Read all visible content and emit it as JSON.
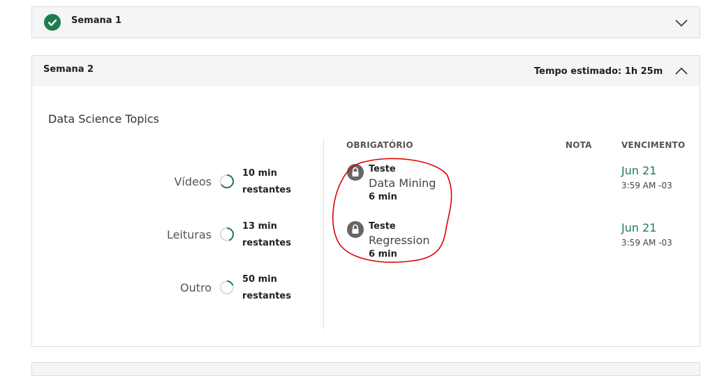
{
  "week1": {
    "title": "Semana 1",
    "completed": true,
    "expanded": false
  },
  "week2": {
    "title": "Semana 2",
    "estimated_time": "Tempo estimado: 1h 25m",
    "expanded": true,
    "course_title": "Data Science Topics",
    "progress": [
      {
        "label": "Vídeos",
        "remaining": "10 min",
        "suffix": "restantes"
      },
      {
        "label": "Leituras",
        "remaining": "13 min",
        "suffix": "restantes"
      },
      {
        "label": "Outro",
        "remaining": "50 min",
        "suffix": "restantes"
      }
    ],
    "columns": {
      "required": "OBRIGATÓRIO",
      "grade": "NOTA",
      "due": "VENCIMENTO"
    },
    "items": [
      {
        "type": "Teste",
        "name": "Data Mining",
        "duration": "6 min",
        "due_date": "Jun 21",
        "due_time": "3:59 AM -03",
        "locked": true
      },
      {
        "type": "Teste",
        "name": "Regression",
        "duration": "6 min",
        "due_date": "Jun 21",
        "due_time": "3:59 AM -03",
        "locked": true
      }
    ]
  },
  "colors": {
    "accent": "#1e7d4f",
    "annotation": "#e00000"
  },
  "icons": {
    "week1_status": "check-circle-icon",
    "collapse": "chevron-up-icon",
    "expand": "chevron-down-icon",
    "item": "lock-icon"
  }
}
